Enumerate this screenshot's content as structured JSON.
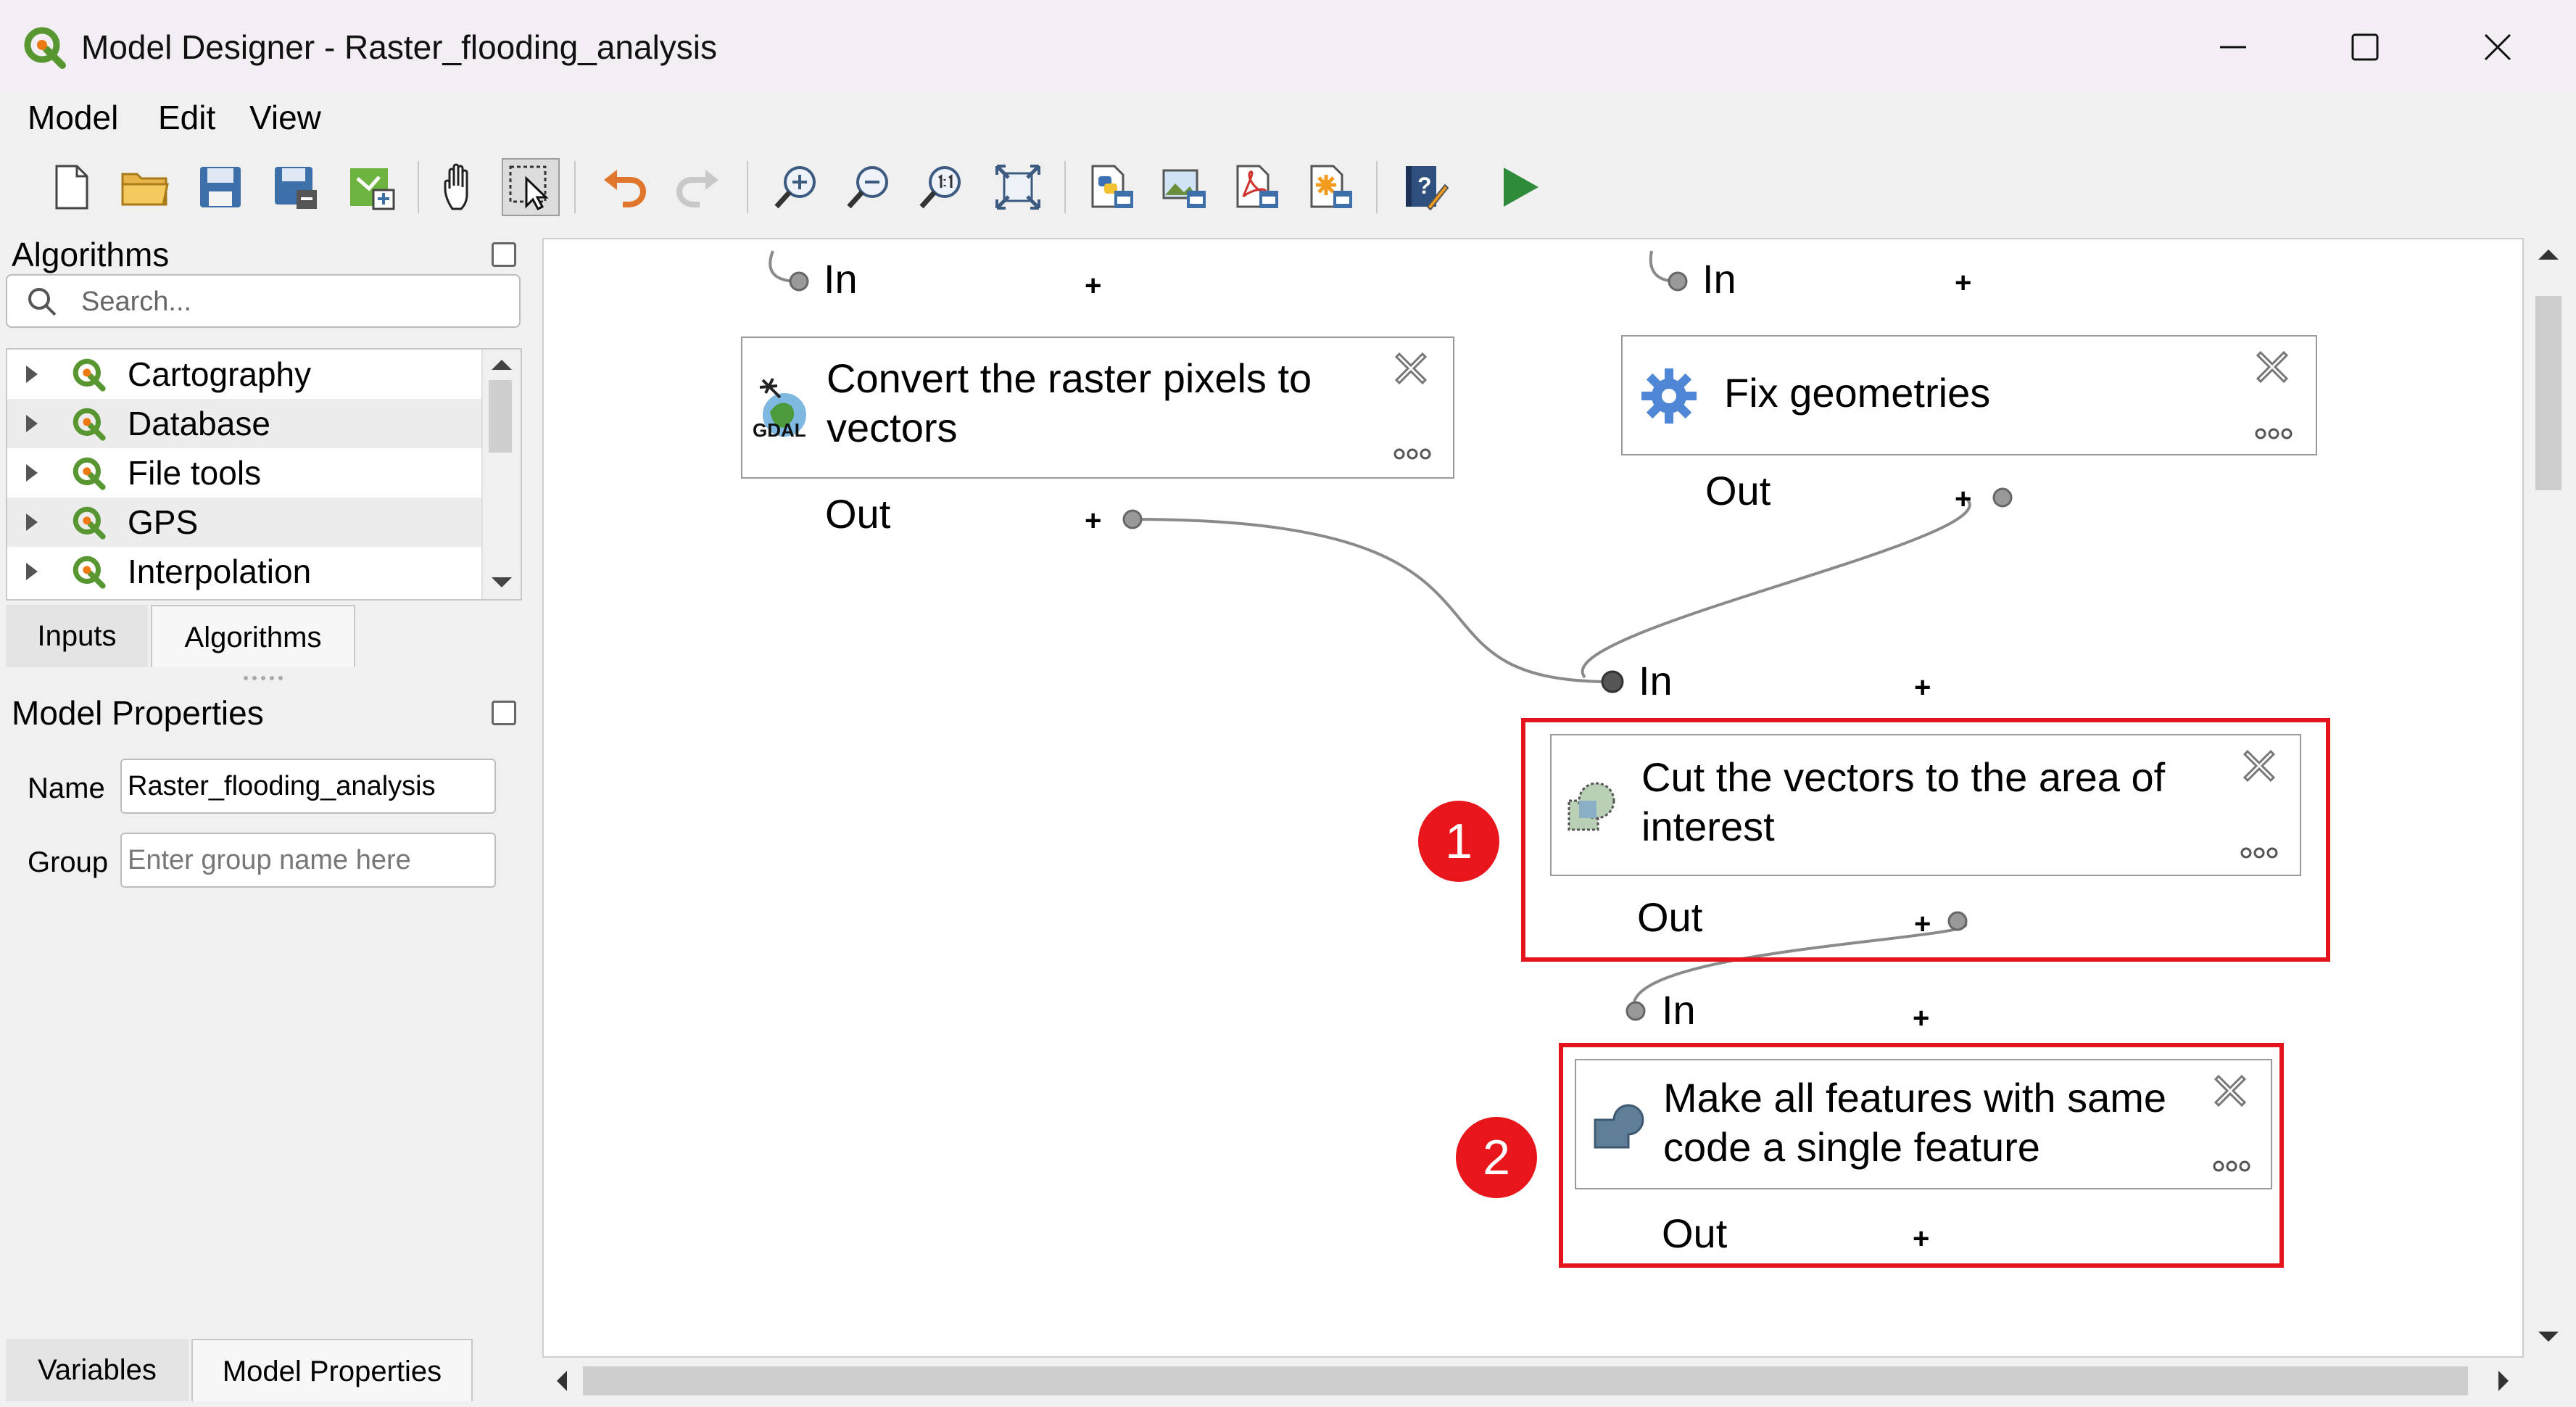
{
  "window": {
    "title": "Model Designer - Raster_flooding_analysis"
  },
  "menu": [
    "Model",
    "Edit",
    "View"
  ],
  "left_panel": {
    "algorithms_title": "Algorithms",
    "search_placeholder": "Search...",
    "tree_items": [
      {
        "label": "Cartography"
      },
      {
        "label": "Database"
      },
      {
        "label": "File tools"
      },
      {
        "label": "GPS"
      },
      {
        "label": "Interpolation"
      }
    ],
    "tabs": {
      "inputs": "Inputs",
      "algorithms": "Algorithms"
    },
    "model_properties_title": "Model Properties",
    "name_label": "Name",
    "name_value": "Raster_flooding_analysis",
    "group_label": "Group",
    "group_placeholder": "Enter group name here",
    "bottom_tabs": {
      "variables": "Variables",
      "model_properties": "Model Properties"
    }
  },
  "canvas": {
    "in_label": "In",
    "out_label": "Out",
    "plus": "+",
    "gdal_label": "GDAL",
    "nodes": [
      {
        "title": "Convert the raster pixels to vectors",
        "icon": "gdal-icon"
      },
      {
        "title": "Fix geometries",
        "icon": "gear-icon"
      },
      {
        "title": "Cut the vectors to the area of interest",
        "icon": "clip-icon"
      },
      {
        "title": "Make all features with same code a single feature",
        "icon": "dissolve-icon"
      }
    ],
    "badges": [
      "1",
      "2"
    ],
    "highlight_color": "#e3141b"
  }
}
